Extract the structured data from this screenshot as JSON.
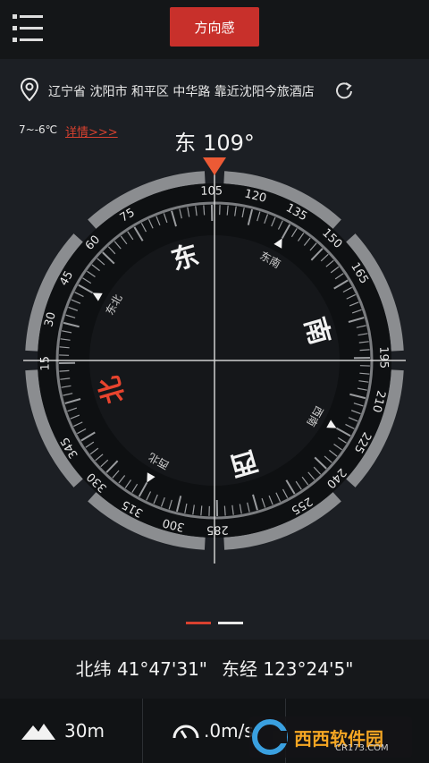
{
  "header": {
    "mode_label": "方向感"
  },
  "location": {
    "address": "辽宁省 沈阳市 和平区 中华路 靠近沈阳今旅酒店"
  },
  "weather": {
    "temp": "7~-6℃",
    "details_link": "详情>>>"
  },
  "heading": {
    "direction": "东",
    "degrees": "109°"
  },
  "compass": {
    "cardinals": {
      "east": "东",
      "south": "南",
      "west": "西",
      "north": "北"
    },
    "intercardinals": {
      "ne": "东北",
      "se": "东南",
      "sw": "西南",
      "nw": "西北"
    },
    "tick_labels": [
      "15",
      "30",
      "45",
      "60",
      "75",
      "105",
      "120",
      "135",
      "150",
      "165",
      "195",
      "210",
      "225",
      "240",
      "255",
      "285",
      "300",
      "315",
      "330",
      "345"
    ]
  },
  "coordinates": {
    "latitude": "北纬 41°47'31\"",
    "longitude": "东经 123°24'5\""
  },
  "footer": {
    "altitude": "30m",
    "speed": ".0m/s"
  },
  "watermark": {
    "brand": "西西软件园",
    "site": "CR173.COM"
  },
  "colors": {
    "accent": "#c8302b",
    "needle": "#ec5a35",
    "north": "#e8442e"
  }
}
